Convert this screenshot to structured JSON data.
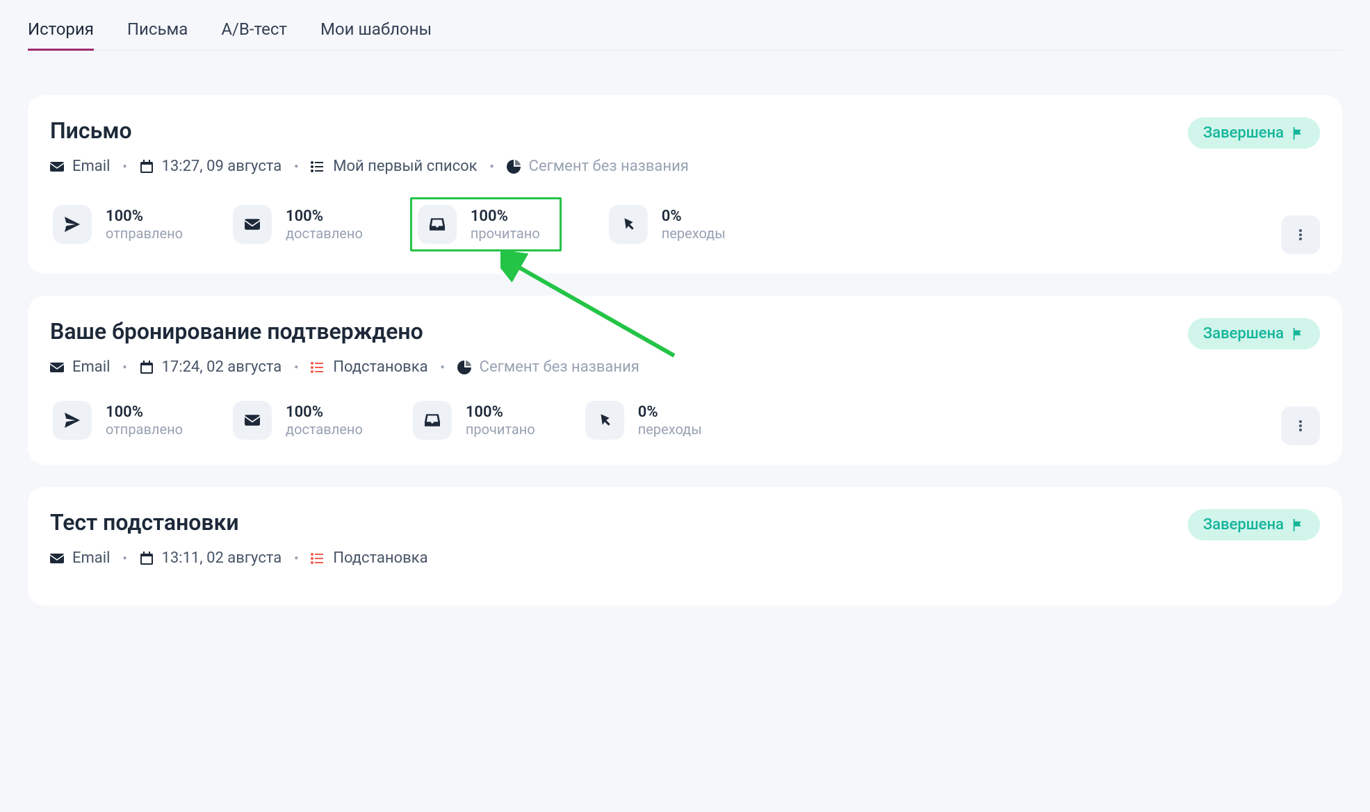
{
  "tabs": [
    "История",
    "Письма",
    "A/B-тест",
    "Мои шаблоны"
  ],
  "activeTab": 0,
  "statusLabel": "Завершена",
  "statLabels": {
    "sent": "отправлено",
    "delivered": "доставлено",
    "read": "прочитано",
    "clicks": "переходы"
  },
  "cards": [
    {
      "title": "Письмо",
      "channel": "Email",
      "timestamp": "13:27, 09 августа",
      "listLabel": "Мой первый список",
      "listHighlight": false,
      "segment": "Сегмент без названия",
      "showSegment": true,
      "highlightRead": true,
      "stats": {
        "sent": "100%",
        "delivered": "100%",
        "read": "100%",
        "clicks": "0%"
      }
    },
    {
      "title": "Ваше бронирование подтверждено",
      "channel": "Email",
      "timestamp": "17:24, 02 августа",
      "listLabel": "Подстановка",
      "listHighlight": true,
      "segment": "Сегмент без названия",
      "showSegment": true,
      "highlightRead": false,
      "stats": {
        "sent": "100%",
        "delivered": "100%",
        "read": "100%",
        "clicks": "0%"
      }
    },
    {
      "title": "Тест подстановки",
      "channel": "Email",
      "timestamp": "13:11, 02 августа",
      "listLabel": "Подстановка",
      "listHighlight": true,
      "segment": "",
      "showSegment": false,
      "highlightRead": false,
      "stats": null
    }
  ]
}
